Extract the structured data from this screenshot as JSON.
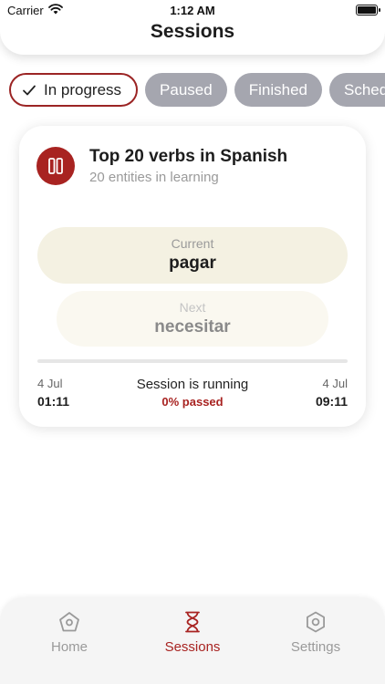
{
  "status_bar": {
    "carrier": "Carrier",
    "time": "1:12 AM"
  },
  "header": {
    "title": "Sessions"
  },
  "filters": [
    {
      "label": "In progress",
      "active": true
    },
    {
      "label": "Paused",
      "active": false
    },
    {
      "label": "Finished",
      "active": false
    },
    {
      "label": "Sched",
      "active": false
    }
  ],
  "session_card": {
    "title": "Top 20 verbs in Spanish",
    "subtitle": "20 entities in learning",
    "current_label": "Current",
    "current_word": "pagar",
    "next_label": "Next",
    "next_word": "necesitar",
    "progress": 0,
    "start_date": "4 Jul",
    "start_time": "01:11",
    "status": "Session is running",
    "passed": "0% passed",
    "end_date": "4 Jul",
    "end_time": "09:11"
  },
  "tabbar": {
    "home": "Home",
    "sessions": "Sessions",
    "settings": "Settings"
  },
  "colors": {
    "accent": "#a82321",
    "chip_inactive": "#a5a6af",
    "current_bg": "#f4f1e2",
    "next_bg": "#faf8f0"
  },
  "icons": [
    "wifi-icon",
    "battery-icon",
    "check-icon",
    "pause-icon",
    "home-icon",
    "hourglass-icon",
    "settings-icon"
  ]
}
